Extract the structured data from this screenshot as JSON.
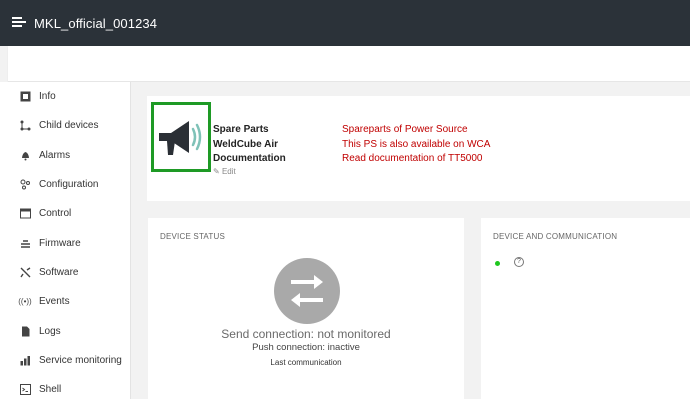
{
  "app": {
    "title": "MKL_official_001234"
  },
  "sidebar": {
    "items": [
      {
        "label": "Info",
        "icon": "info-icon"
      },
      {
        "label": "Child devices",
        "icon": "child-devices-icon"
      },
      {
        "label": "Alarms",
        "icon": "bell-icon"
      },
      {
        "label": "Configuration",
        "icon": "configuration-icon"
      },
      {
        "label": "Control",
        "icon": "control-icon"
      },
      {
        "label": "Firmware",
        "icon": "firmware-icon"
      },
      {
        "label": "Software",
        "icon": "software-icon"
      },
      {
        "label": "Events",
        "icon": "events-icon"
      },
      {
        "label": "Logs",
        "icon": "logs-icon"
      },
      {
        "label": "Service monitoring",
        "icon": "bar-chart-icon"
      },
      {
        "label": "Shell",
        "icon": "terminal-icon"
      }
    ]
  },
  "header": {
    "links": [
      {
        "label": "Spare Parts",
        "value": "Spareparts of Power Source"
      },
      {
        "label": "WeldCube Air",
        "value": "This PS is also available on WCA"
      },
      {
        "label": "Documentation",
        "value": "Read documentation of TT5000"
      }
    ],
    "edit_label": "Edit",
    "logo_icon": "megaphone-icon",
    "logo_border_color": "#1e9a25",
    "link_color": "#c00000"
  },
  "device_status": {
    "title": "DEVICE STATUS",
    "send_connection": "Send connection: not monitored",
    "push_connection": "Push connection: inactive",
    "last_communication": "Last communication"
  },
  "device_communication": {
    "title": "DEVICE AND COMMUNICATION",
    "status_color": "#1ec71e"
  }
}
